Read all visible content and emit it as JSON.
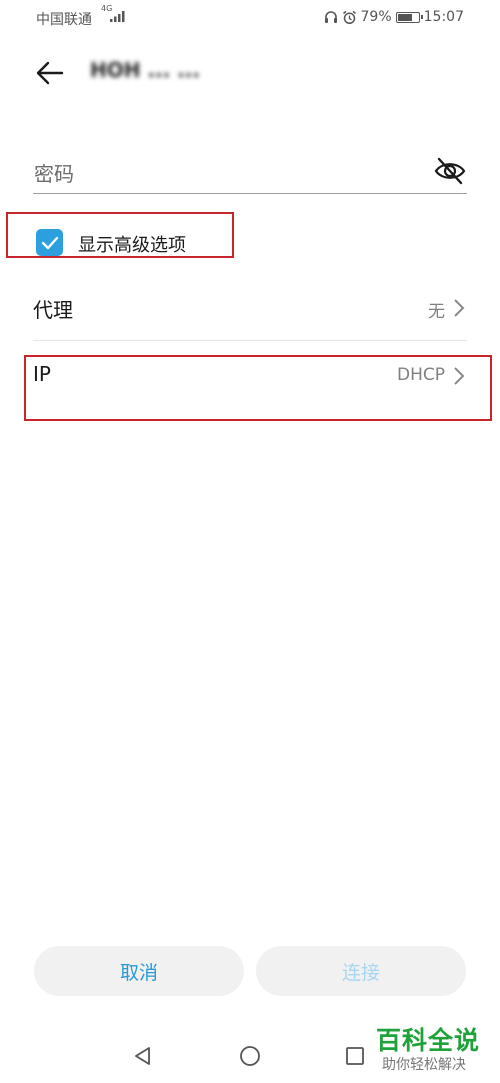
{
  "status_bar": {
    "carrier": "中国联通",
    "network_badge": "4G",
    "battery_percent": "79%",
    "battery_level": 0.79,
    "time": "15:07",
    "icons": [
      "signal-icon",
      "headset-icon",
      "alarm-icon",
      "battery-icon"
    ]
  },
  "header": {
    "title": "HOH ... ..."
  },
  "password_field": {
    "placeholder": "密码",
    "visibility_icon": "eye-slash-icon"
  },
  "advanced_options": {
    "label": "显示高级选项",
    "checked": true
  },
  "rows": [
    {
      "label": "代理",
      "value": "无"
    },
    {
      "label": "IP",
      "value": "DHCP"
    }
  ],
  "buttons": {
    "cancel": "取消",
    "connect": "连接"
  },
  "nav": [
    "back-triangle-icon",
    "home-circle-icon",
    "recent-square-icon"
  ],
  "watermark": {
    "title": "百科全说",
    "subtitle": "助你轻松解决"
  },
  "colors": {
    "accent": "#2c9fdf",
    "highlight": "#c8242b",
    "connect_disabled": "#a9d6ef",
    "watermark": "#1fa23a"
  }
}
